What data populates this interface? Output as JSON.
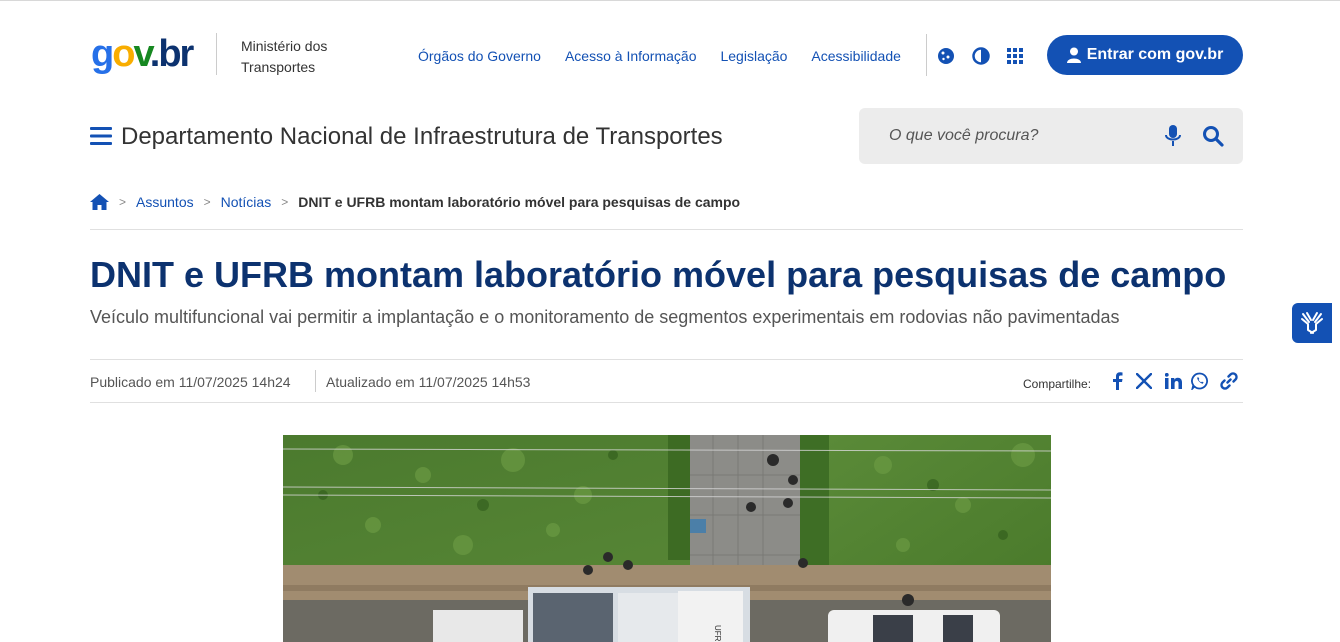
{
  "header": {
    "logo_text": "gov.br",
    "ministry": "Ministério dos Transportes",
    "links": [
      "Órgãos do Governo",
      "Acesso à Informação",
      "Legislação",
      "Acessibilidade"
    ],
    "tool_icons": [
      "cookie-icon",
      "contrast-icon",
      "apps-grid-icon"
    ],
    "login_label": "Entrar com gov.br"
  },
  "site": {
    "title": "Departamento Nacional de Infraestrutura de Transportes"
  },
  "search": {
    "placeholder": "O que você procura?"
  },
  "breadcrumb": {
    "items": [
      "Assuntos",
      "Notícias"
    ],
    "current": "DNIT e UFRB montam laboratório móvel para pesquisas de campo"
  },
  "article": {
    "title": "DNIT e UFRB montam laboratório móvel para pesquisas de campo",
    "subtitle": "Veículo multifuncional vai permitir a implantação e o monitoramento de segmentos experimentais em rodovias não pavimentadas",
    "published": "Publicado em 11/07/2025 14h24",
    "updated": "Atualizado em 11/07/2025 14h53",
    "share_label": "Compartilhe:",
    "share_icons": [
      "facebook-icon",
      "x-icon",
      "linkedin-icon",
      "whatsapp-icon",
      "link-icon"
    ]
  },
  "photo": {
    "truck_text": "UFRB"
  },
  "colors": {
    "primary": "#1351b4",
    "title": "#0c326f",
    "text": "#333333"
  }
}
